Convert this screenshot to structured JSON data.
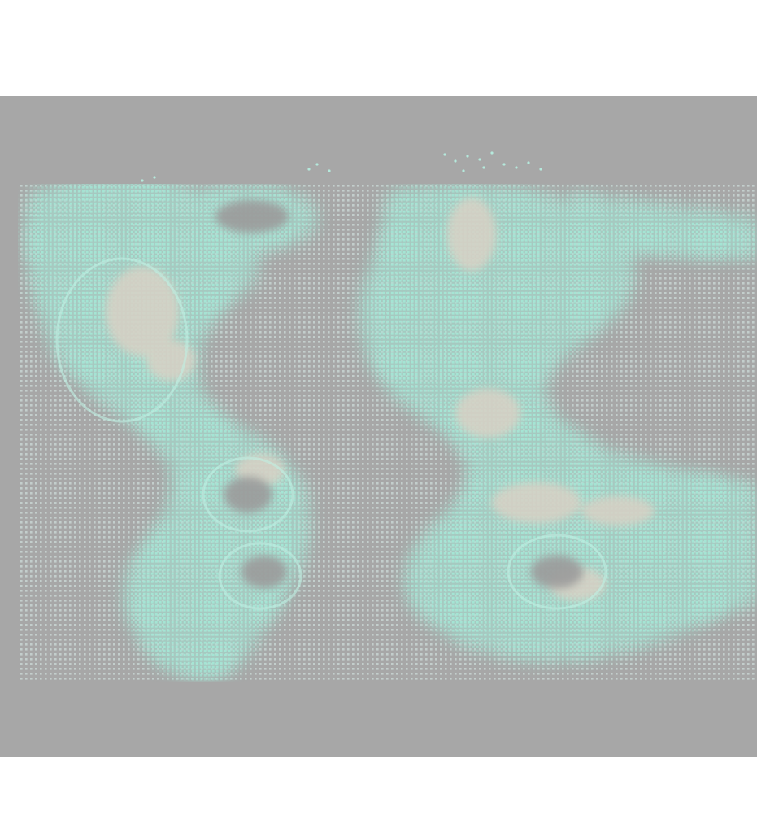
{
  "scene": {
    "description_visible_text": "",
    "colors": {
      "page_background": "#ffffff",
      "panel_background": "#a7a7a7",
      "dot_grid": "#c9d6d3",
      "particle_cyan": "#9fe3d2",
      "particle_cyan_light": "#b9ece0",
      "particle_beige": "#d6d0c4"
    }
  }
}
